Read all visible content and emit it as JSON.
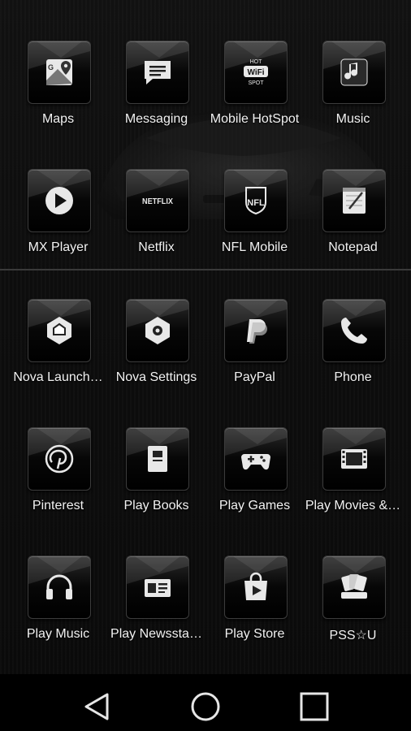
{
  "apps": [
    {
      "label": "Maps",
      "icon": "maps-icon"
    },
    {
      "label": "Messaging",
      "icon": "messaging-icon"
    },
    {
      "label": "Mobile HotSpot",
      "icon": "hotspot-icon",
      "icon_text": [
        "HOT",
        "WiFi",
        "SPOT"
      ]
    },
    {
      "label": "Music",
      "icon": "music-icon"
    },
    {
      "label": "MX Player",
      "icon": "mx-player-icon"
    },
    {
      "label": "Netflix",
      "icon": "netflix-icon",
      "icon_text": "NETFLIX"
    },
    {
      "label": "NFL Mobile",
      "icon": "nfl-icon",
      "icon_text": "NFL"
    },
    {
      "label": "Notepad",
      "icon": "notepad-icon"
    },
    {
      "label": "Nova Launch…",
      "icon": "nova-launcher-icon"
    },
    {
      "label": "Nova Settings",
      "icon": "nova-settings-icon"
    },
    {
      "label": "PayPal",
      "icon": "paypal-icon"
    },
    {
      "label": "Phone",
      "icon": "phone-icon"
    },
    {
      "label": "Pinterest",
      "icon": "pinterest-icon"
    },
    {
      "label": "Play Books",
      "icon": "play-books-icon"
    },
    {
      "label": "Play Games",
      "icon": "play-games-icon"
    },
    {
      "label": "Play Movies &…",
      "icon": "play-movies-icon"
    },
    {
      "label": "Play Music",
      "icon": "play-music-icon"
    },
    {
      "label": "Play Newssta…",
      "icon": "play-newsstand-icon"
    },
    {
      "label": "Play Store",
      "icon": "play-store-icon"
    },
    {
      "label": "PSS☆U",
      "icon": "pss-icon"
    }
  ],
  "navbar": {
    "back_icon": "back-triangle-icon",
    "home_icon": "home-circle-icon",
    "recents_icon": "recents-square-icon"
  },
  "colors": {
    "label": "#f2f2f2",
    "icon": "#e8e8e8",
    "background": "#0b0b0b"
  }
}
